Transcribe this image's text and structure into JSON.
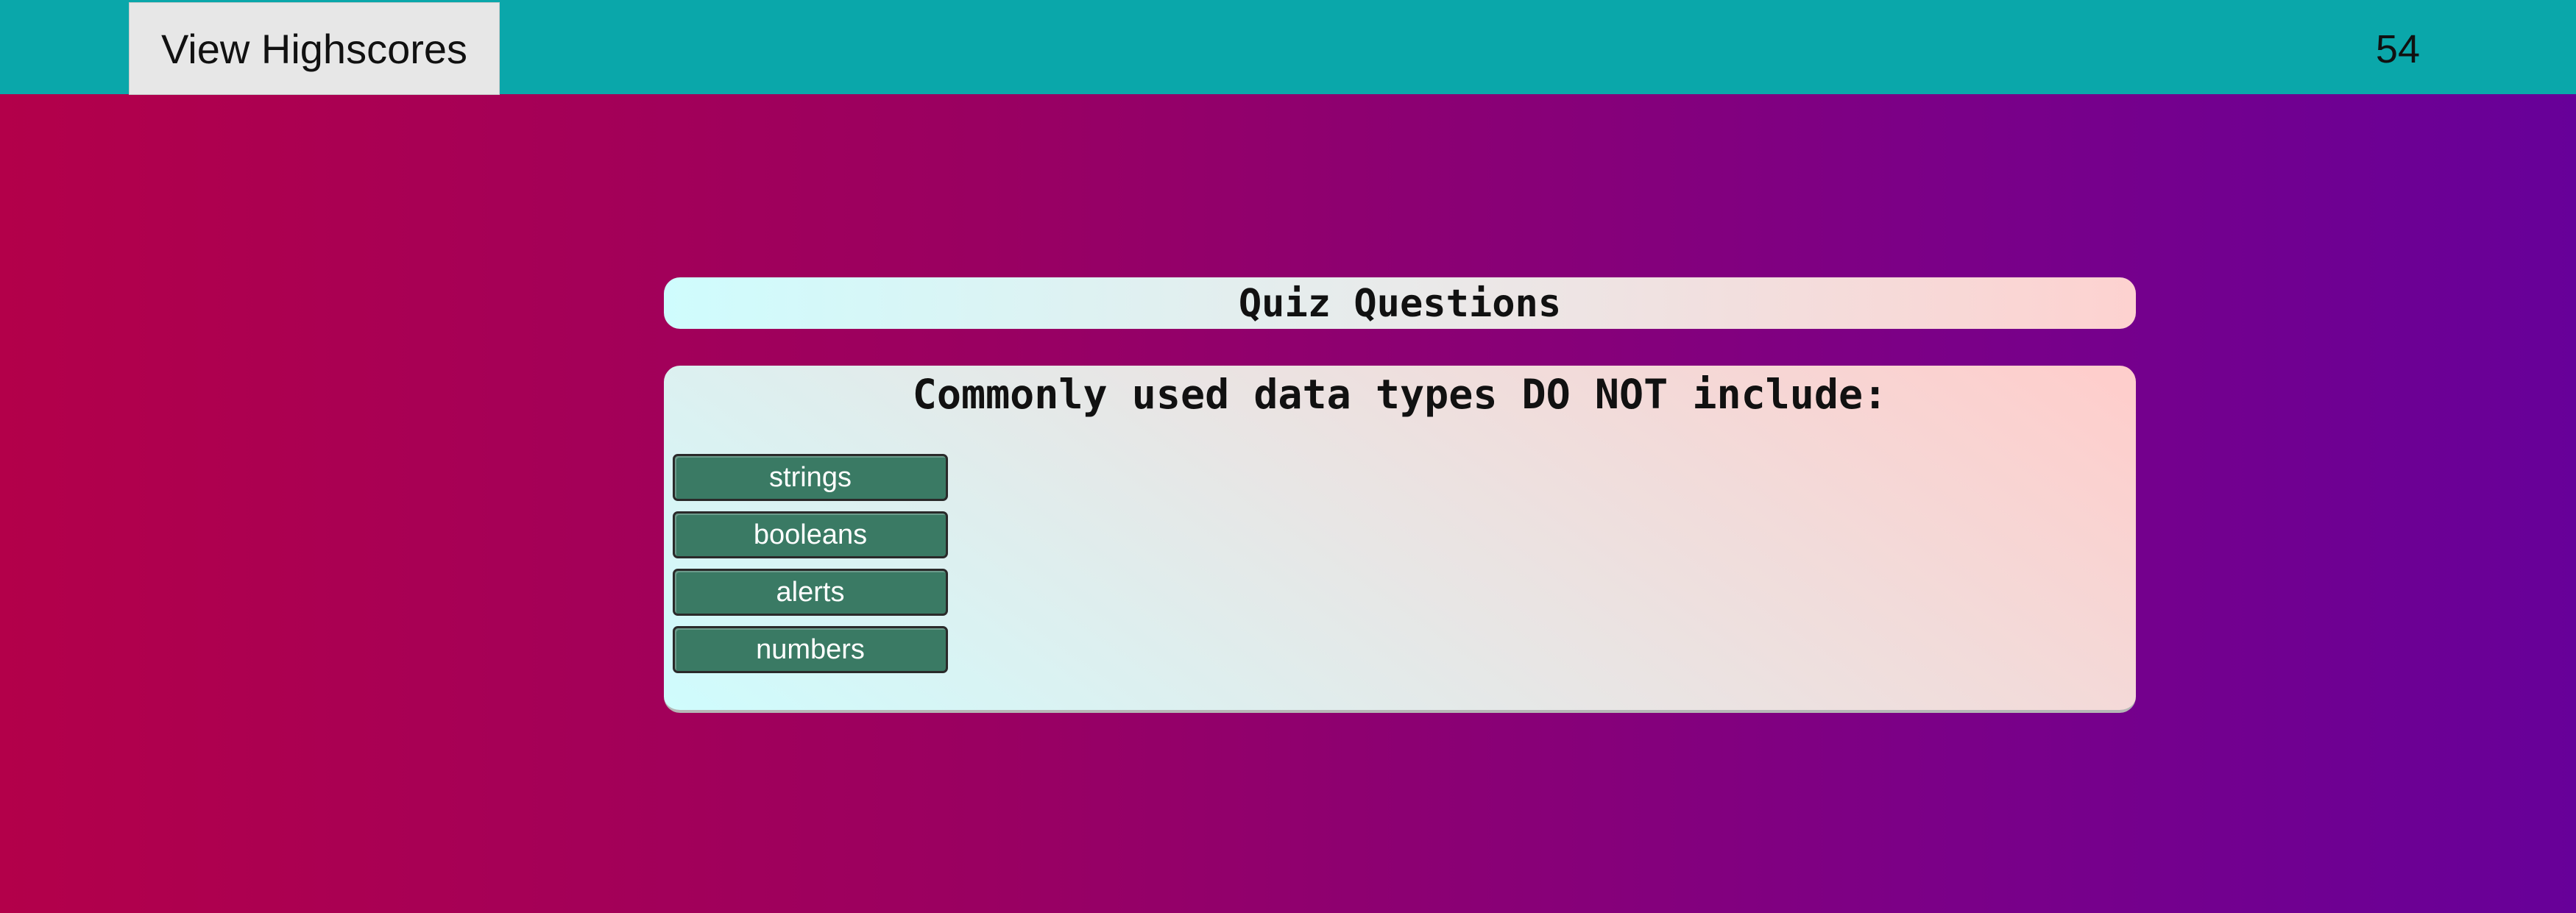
{
  "header": {
    "highscores_label": "View Highscores",
    "timer": "54"
  },
  "quiz": {
    "title": "Quiz Questions",
    "question": "Commonly used data types DO NOT include:",
    "answers": [
      {
        "label": "strings"
      },
      {
        "label": "booleans"
      },
      {
        "label": "alerts"
      },
      {
        "label": "numbers"
      }
    ]
  },
  "colors": {
    "topbar": "#0aa7aa",
    "answer_button": "#3a7a64",
    "background_start": "#b3004a",
    "background_end": "#670099"
  }
}
